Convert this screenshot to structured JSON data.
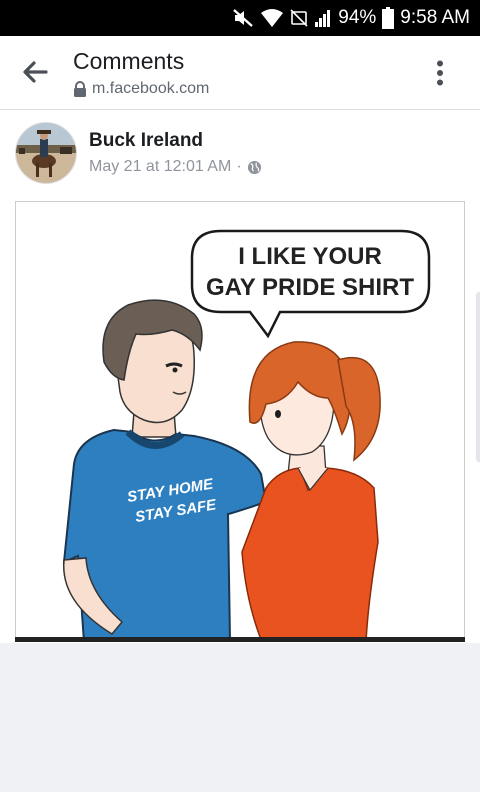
{
  "status_bar": {
    "battery": "94%",
    "time": "9:58 AM",
    "icons": [
      "mute-icon",
      "wifi-icon",
      "no-sim-icon",
      "signal-icon",
      "battery-icon"
    ]
  },
  "header": {
    "title": "Comments",
    "url": "m.facebook.com",
    "icons": [
      "back-arrow-icon",
      "lock-icon",
      "more-vertical-icon"
    ]
  },
  "post": {
    "author": "Buck Ireland",
    "date": "May 21 at 12:01 AM",
    "separator": "·",
    "privacy_icon": "globe-icon",
    "image": {
      "speech_bubble": [
        "I LIKE YOUR",
        "GAY PRIDE SHIRT"
      ],
      "shirt_text": [
        "STAY HOME",
        "STAY SAFE"
      ]
    }
  },
  "colors": {
    "status_bar_bg": "#000000",
    "page_bg": "#f0f1f4",
    "text_primary": "#1c1e21",
    "text_secondary": "#90949c",
    "blue_shirt": "#2d7fc0",
    "orange_shirt": "#e8531f"
  }
}
